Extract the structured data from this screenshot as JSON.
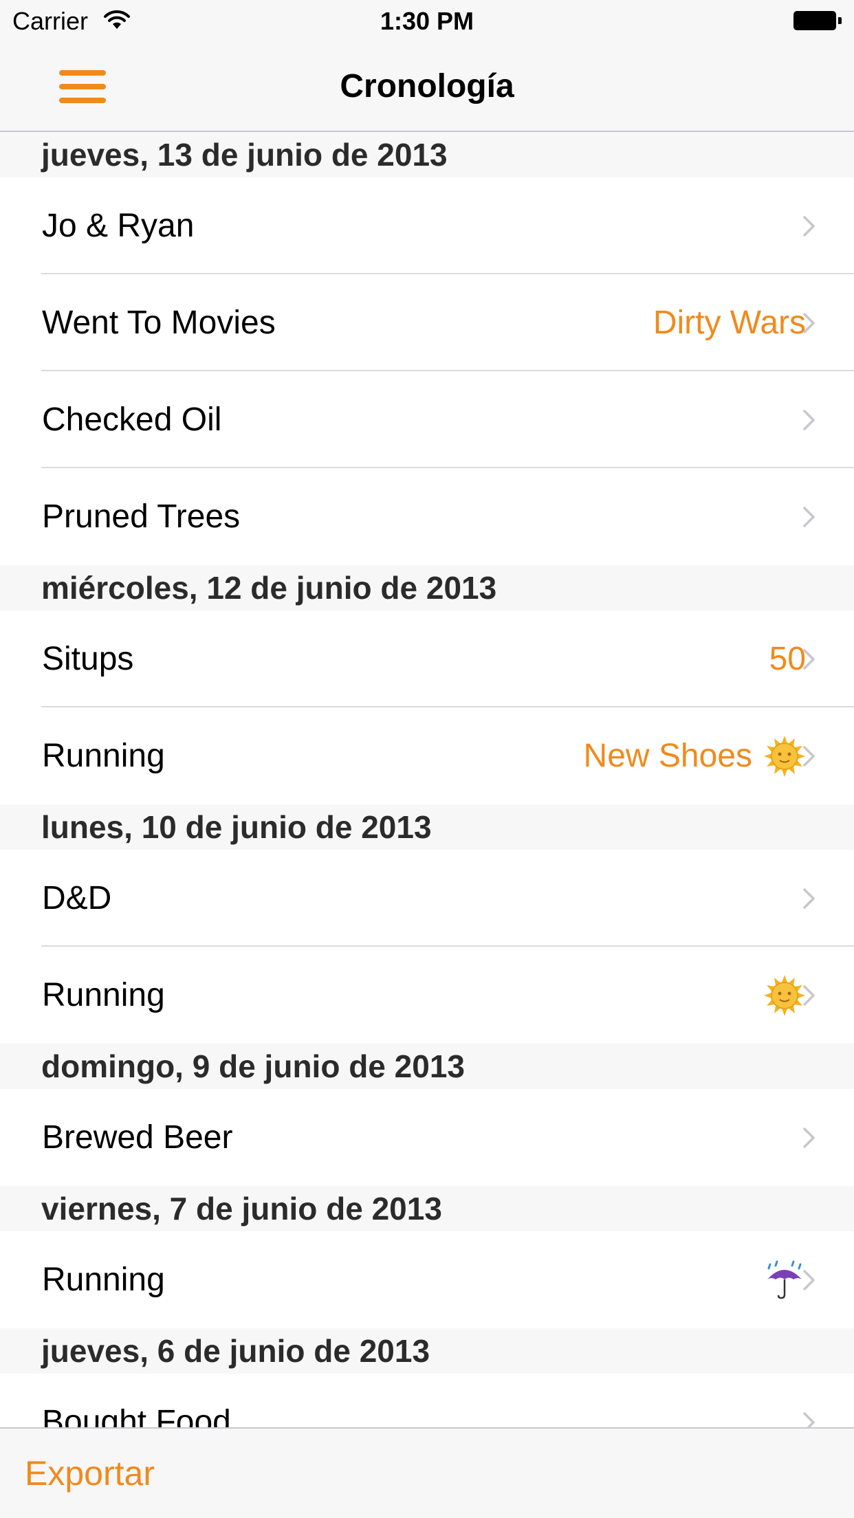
{
  "status_bar": {
    "carrier": "Carrier",
    "time": "1:30 PM"
  },
  "nav": {
    "title": "Cronología",
    "menu_icon": "hamburger-menu-icon"
  },
  "accent_color": "#f08a1d",
  "sections": [
    {
      "header": "jueves, 13 de junio de 2013",
      "rows": [
        {
          "title": "Jo & Ryan",
          "detail": "",
          "icon": ""
        },
        {
          "title": "Went To Movies",
          "detail": "Dirty Wars",
          "icon": ""
        },
        {
          "title": "Checked Oil",
          "detail": "",
          "icon": ""
        },
        {
          "title": "Pruned Trees",
          "detail": "",
          "icon": ""
        }
      ]
    },
    {
      "header": "miércoles, 12 de junio de 2013",
      "rows": [
        {
          "title": "Situps",
          "detail": "50",
          "icon": ""
        },
        {
          "title": "Running",
          "detail": "New Shoes",
          "icon": "sun-icon"
        }
      ]
    },
    {
      "header": "lunes, 10 de junio de 2013",
      "rows": [
        {
          "title": "D&D",
          "detail": "",
          "icon": ""
        },
        {
          "title": "Running",
          "detail": "",
          "icon": "sun-icon"
        }
      ]
    },
    {
      "header": "domingo, 9 de junio de 2013",
      "rows": [
        {
          "title": "Brewed Beer",
          "detail": "",
          "icon": ""
        }
      ]
    },
    {
      "header": "viernes, 7 de junio de 2013",
      "rows": [
        {
          "title": "Running",
          "detail": "",
          "icon": "umbrella-icon"
        }
      ]
    },
    {
      "header": "jueves, 6 de junio de 2013",
      "rows": [
        {
          "title": "Bought Food",
          "detail": "",
          "icon": ""
        }
      ]
    }
  ],
  "toolbar": {
    "export_label": "Exportar"
  }
}
